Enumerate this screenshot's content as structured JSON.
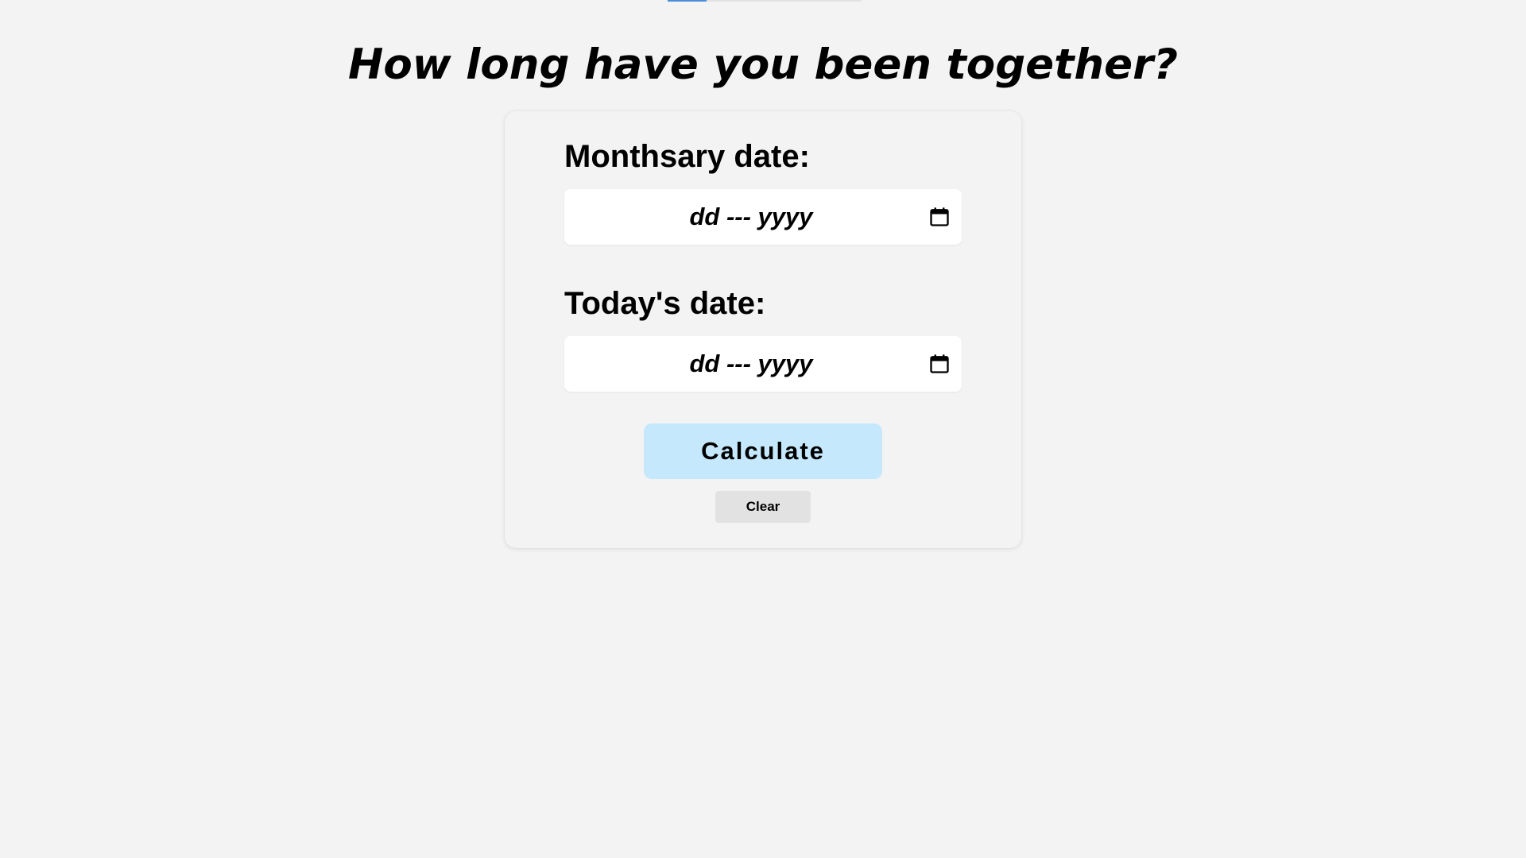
{
  "top_progress": {
    "fill_percent": 20,
    "fill_color": "#4a90d9"
  },
  "page": {
    "title": "How long have you been together?"
  },
  "form": {
    "monthsary": {
      "label": "Monthsary date:",
      "placeholder": "dd --- yyyy",
      "icon": "calendar-icon"
    },
    "today": {
      "label": "Today's date:",
      "placeholder": "dd --- yyyy",
      "icon": "calendar-icon"
    },
    "calculate_label": "Calculate",
    "clear_label": "Clear"
  },
  "colors": {
    "background": "#f3f3f3",
    "calculate_button": "#c5e8fc",
    "clear_button": "#e2e2e2"
  }
}
